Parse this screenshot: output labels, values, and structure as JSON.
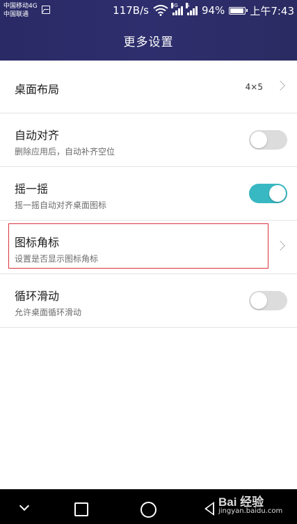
{
  "status_bar": {
    "carrier_1": "中国移动4G",
    "carrier_2": "中国联通",
    "speed": "117B/s",
    "signal_1_tag": "4G",
    "signal_2_tag": "G",
    "battery": "94%",
    "time": "上午7:43",
    "icons": [
      "image-icon",
      "wifi-icon",
      "signal-icon",
      "battery-icon"
    ]
  },
  "header": {
    "title": "更多设置"
  },
  "settings": [
    {
      "title": "桌面布局",
      "value": "4×5",
      "control": "chevron"
    },
    {
      "title": "自动对齐",
      "subtitle": "删除应用后，自动补齐空位",
      "control": "toggle",
      "enabled": false
    },
    {
      "title": "摇一摇",
      "subtitle": "摇一摇自动对齐桌面图标",
      "control": "toggle",
      "enabled": true
    },
    {
      "title": "图标角标",
      "subtitle": "设置是否显示图标角标",
      "control": "chevron",
      "highlighted": true
    },
    {
      "title": "循环滑动",
      "subtitle": "允许桌面循环滑动",
      "control": "toggle",
      "enabled": false
    }
  ],
  "nav_bar": {
    "icons": [
      "chevron-down-icon",
      "recents-icon",
      "home-icon",
      "back-icon"
    ]
  },
  "watermark": {
    "text": "Bai 经验",
    "url": "jingyan.baidu.com"
  },
  "colors": {
    "header_bg": "#2b2b66",
    "toggle_on": "#37b8c2",
    "toggle_off": "#dcdcdc",
    "highlight_border": "#d9343b"
  }
}
